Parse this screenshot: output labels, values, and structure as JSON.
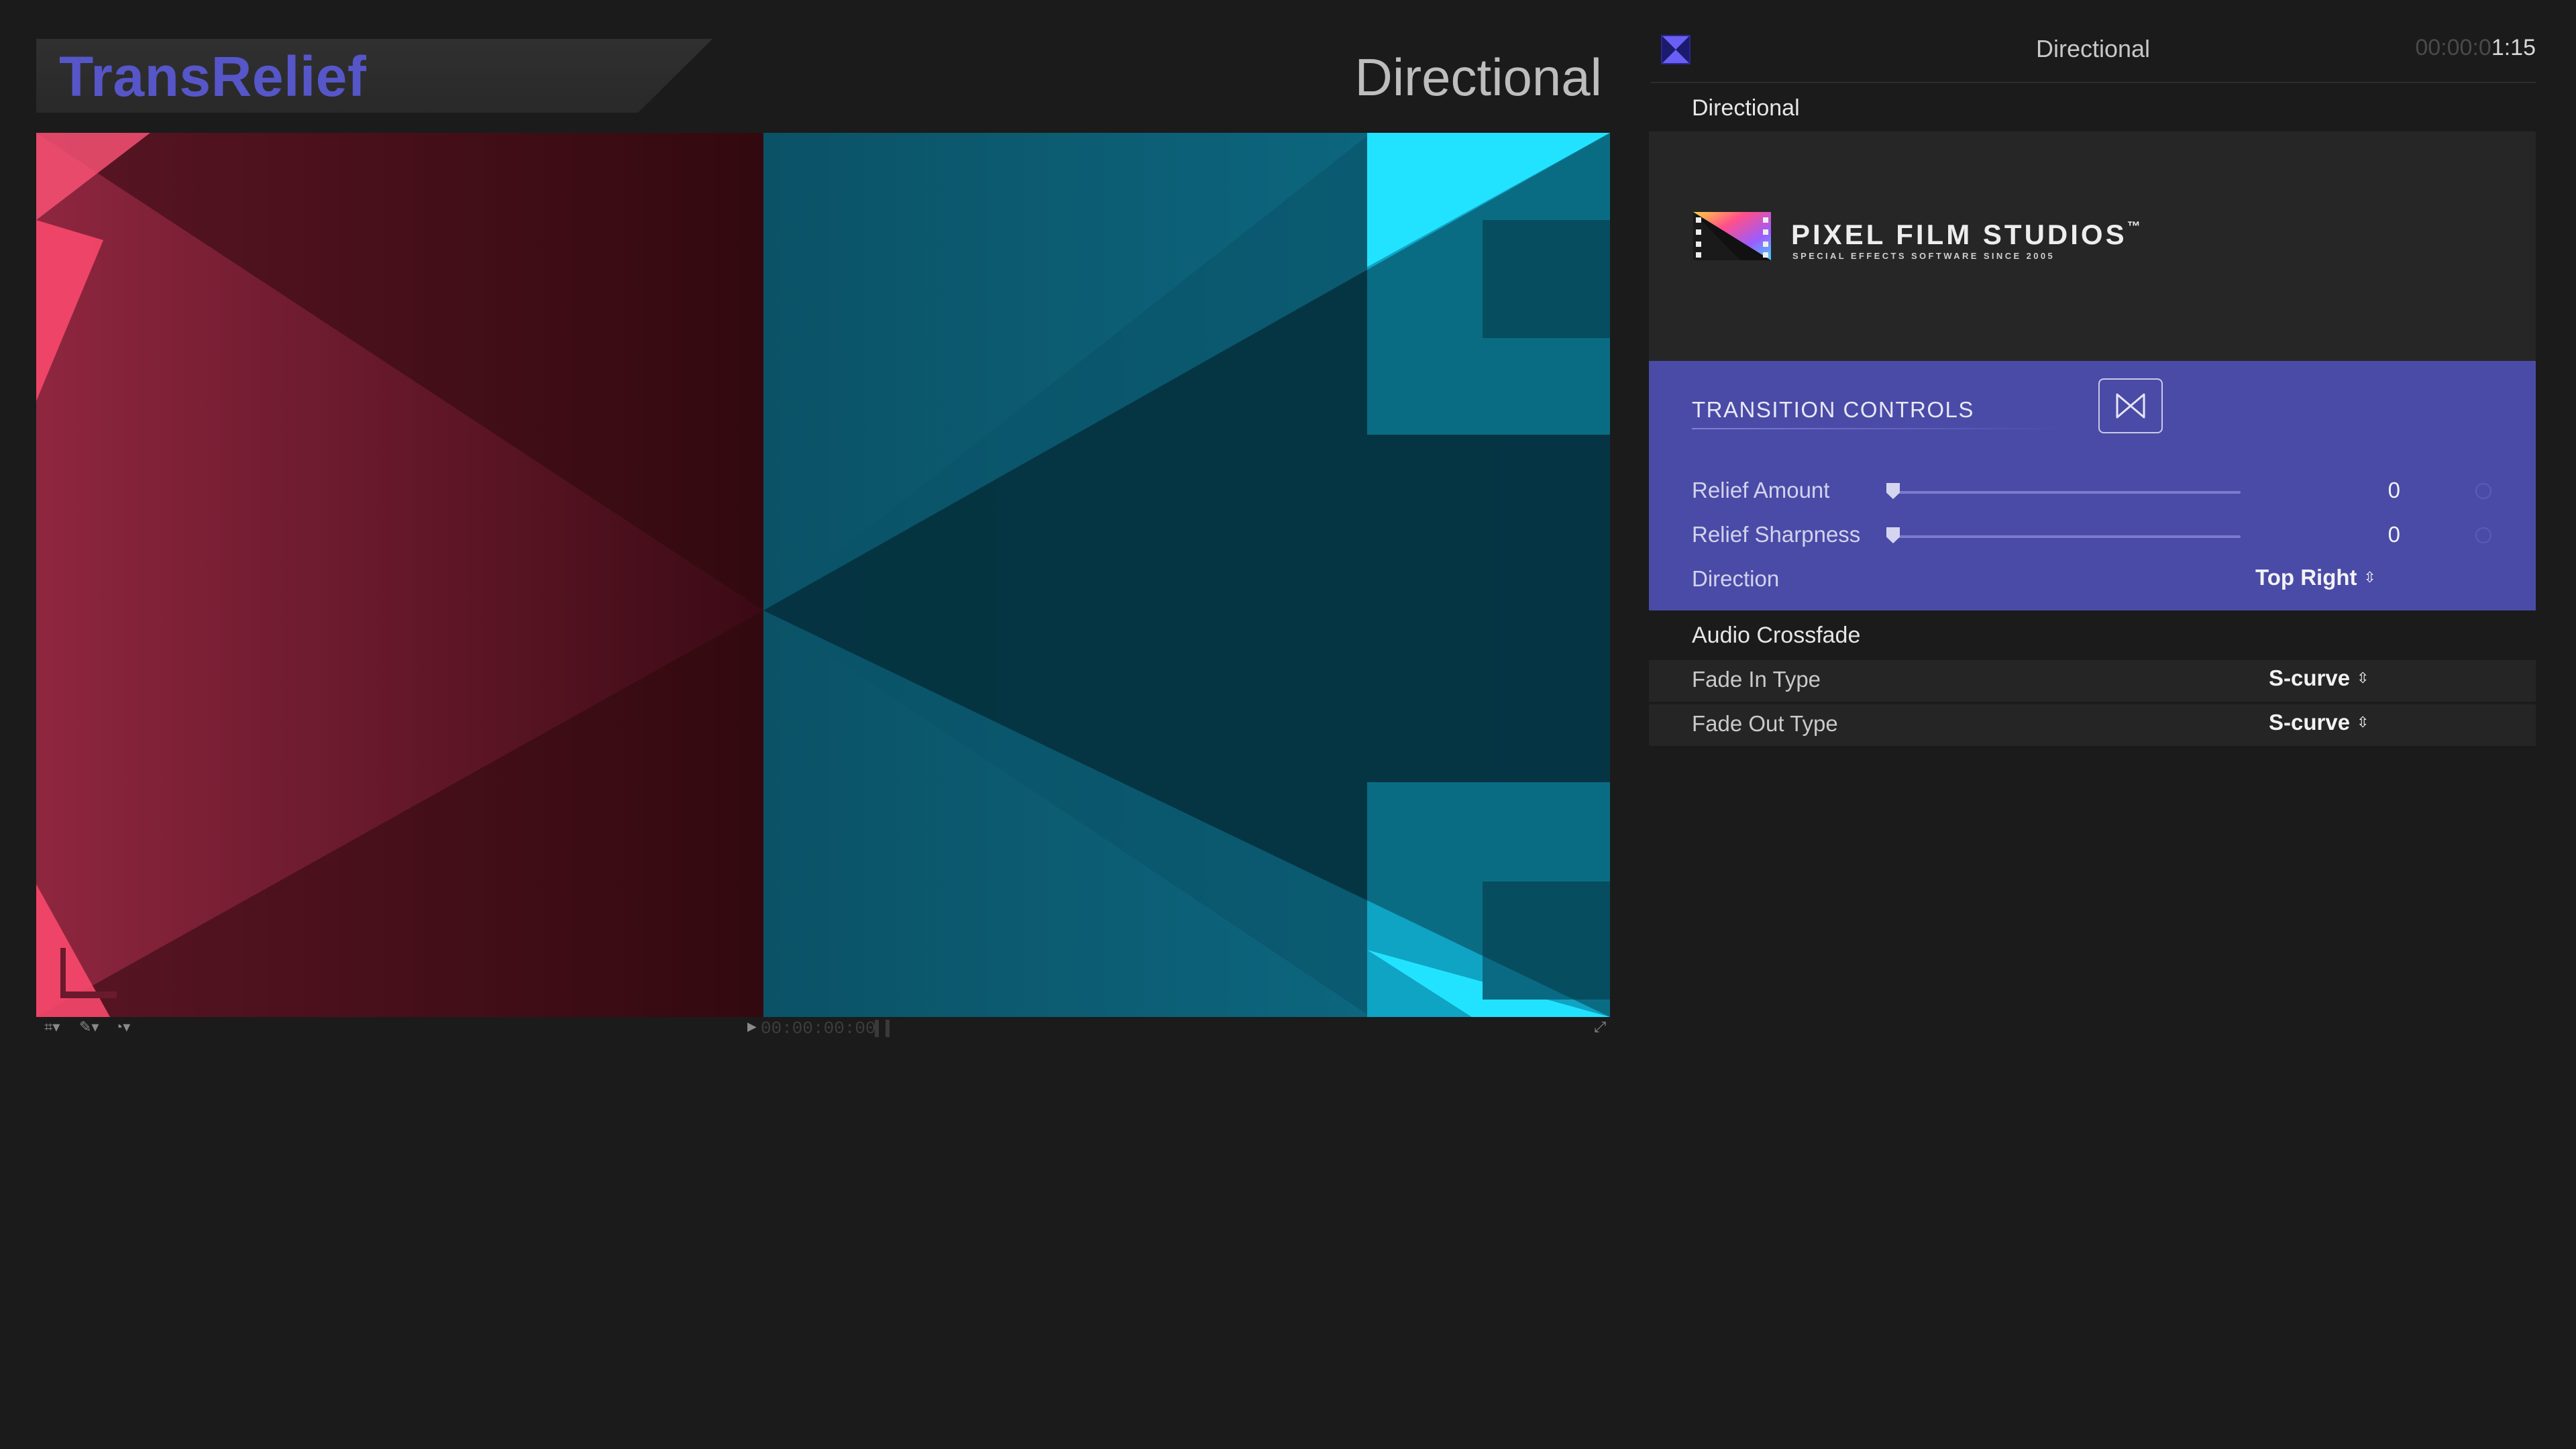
{
  "viewer": {
    "app_title": "TransRelief",
    "effect_title": "Directional",
    "timecode": "00:00:00:00"
  },
  "inspector": {
    "header_title": "Directional",
    "timecode_dim": "00:00:0",
    "timecode_bright": "1:15",
    "section_title": "Directional",
    "logo": {
      "name": "PIXEL FILM STUDIOS",
      "trademark": "™",
      "tagline": "SPECIAL EFFECTS SOFTWARE SINCE 2005"
    },
    "transition_controls": {
      "title": "TRANSITION CONTROLS",
      "params": [
        {
          "label": "Relief Amount",
          "value": "0",
          "slider": 0
        },
        {
          "label": "Relief Sharpness",
          "value": "0",
          "slider": 0
        }
      ],
      "direction": {
        "label": "Direction",
        "value": "Top Right"
      }
    },
    "audio": {
      "title": "Audio Crossfade",
      "fade_in": {
        "label": "Fade In Type",
        "value": "S-curve"
      },
      "fade_out": {
        "label": "Fade Out Type",
        "value": "S-curve"
      }
    }
  },
  "colors": {
    "accent": "#5656c9",
    "controls_panel": "#4a4ba7",
    "background": "#1b1b1b"
  }
}
